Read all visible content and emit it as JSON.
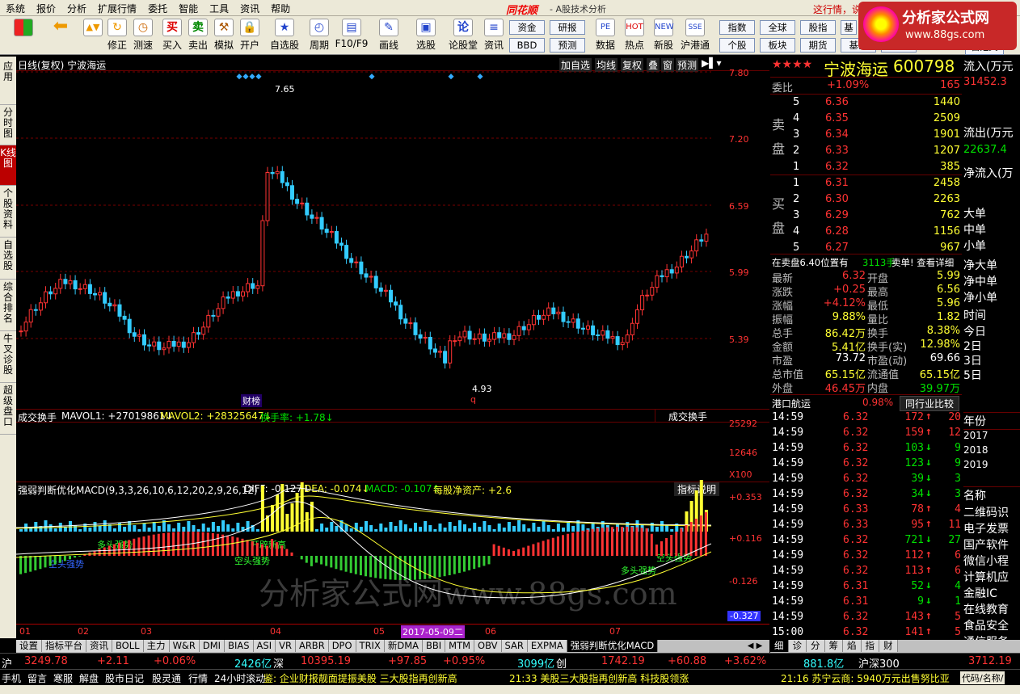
{
  "menu": [
    "系统",
    "报价",
    "分析",
    "扩展行情",
    "委托",
    "智能",
    "工具",
    "资讯",
    "帮助"
  ],
  "brand": "同花顺",
  "app_title": "- A股技术分析",
  "news_ticker": "这行情，说",
  "badge": {
    "t1": "分析家公式网",
    "t2": "www.88gs.com"
  },
  "toolbar": {
    "buttons": [
      "",
      "",
      "修正",
      "测速",
      "买入",
      "卖出",
      "模拟",
      "开户",
      "自选股",
      "周期",
      "F10/F9",
      "画线",
      "选股",
      "论股堂",
      "资讯",
      "数据",
      "热点",
      "新股",
      "沪港通"
    ],
    "quick": [
      [
        "资金",
        "研报"
      ],
      [
        "BBD",
        "预测"
      ]
    ],
    "right": [
      [
        "指数",
        "全球",
        "股指",
        "基"
      ],
      [
        "个股",
        "板块",
        "期货",
        "基金"
      ]
    ],
    "right_tail": [
      "外汇",
      "自定义"
    ]
  },
  "left_tabs": [
    "应用",
    "分时图",
    "K线图",
    "个股资料",
    "自选股",
    "综合排名",
    "牛叉诊股",
    "超级盘口"
  ],
  "chart": {
    "header": "日线(复权) 宁波海运",
    "buttons": [
      "加自选",
      "均线",
      "复权",
      "叠",
      "窗",
      "预测"
    ],
    "price_labels": [
      "7.80",
      "7.20",
      "6.59",
      "5.99",
      "5.39"
    ],
    "high_mark": "7.65",
    "low_mark": "4.93",
    "low_flag": "q",
    "event_flag": "财榜",
    "vol_header": {
      "name": "成交换手",
      "mavol1": "MAVOL1: +27019861↓",
      "mavol2": "MAVOL2: +28325647↓",
      "hsl": "换手率: +1.78↓"
    },
    "vol_select": "成交换手",
    "vol_labels": [
      "25292",
      "12646",
      "X100"
    ],
    "macd_header": {
      "name": "强弱判断优化MACD(9,3,3,26,10,6,12,20,2,9,26,12)",
      "diff": "DIFF: -0.127↓",
      "dea": "DEA: -0.074↓",
      "macd": "MACD: -0.107↑",
      "nav": "每股净资产: +2.6"
    },
    "macd_btn": "指标说明",
    "macd_labels": [
      "+0.353",
      "+0.116",
      "-0.126",
      "-0.327"
    ],
    "macd_tags": [
      "空头强势",
      "多头强势",
      "开辟新高",
      "空头强势",
      "多头强势",
      "空头强势"
    ],
    "watermark": "分析家公式网www.88gs.com",
    "x_labels": [
      "01",
      "02",
      "03",
      "04",
      "05",
      "06",
      "07"
    ],
    "date_cursor": "2017-05-09二"
  },
  "quote": {
    "stars": "★★★★",
    "name": "宁波海运",
    "code": "600798",
    "weibi_label": "委比",
    "weibi": "+1.09%",
    "weibi_val": "165",
    "sell_label": [
      "卖",
      "盘"
    ],
    "buy_label": [
      "买",
      "盘"
    ],
    "asks": [
      [
        "5",
        "6.36",
        "1440"
      ],
      [
        "4",
        "6.35",
        "2509"
      ],
      [
        "3",
        "6.34",
        "1901"
      ],
      [
        "2",
        "6.33",
        "1207"
      ],
      [
        "1",
        "6.32",
        "385"
      ]
    ],
    "bids": [
      [
        "1",
        "6.31",
        "2458"
      ],
      [
        "2",
        "6.30",
        "2263"
      ],
      [
        "3",
        "6.29",
        "762"
      ],
      [
        "4",
        "6.28",
        "1156"
      ],
      [
        "5",
        "6.27",
        "967"
      ]
    ],
    "pending": "在卖盘6.40位置有",
    "pending_qty": "3113手",
    "pending_tail": "卖单! 查看详细",
    "stats": [
      [
        "最新",
        "6.32",
        "开盘",
        "5.99"
      ],
      [
        "涨跌",
        "+0.25",
        "最高",
        "6.56"
      ],
      [
        "涨幅",
        "+4.12%",
        "最低",
        "5.96"
      ],
      [
        "振幅",
        "9.88%",
        "量比",
        "1.82"
      ],
      [
        "总手",
        "86.42万",
        "换手",
        "8.38%"
      ],
      [
        "金额",
        "5.41亿",
        "换手(实)",
        "12.98%"
      ],
      [
        "市盈",
        "73.72",
        "市盈(动)",
        "69.66"
      ],
      [
        "总市值",
        "65.15亿",
        "流通值",
        "65.15亿"
      ],
      [
        "外盘",
        "46.45万",
        "内盘",
        "39.97万"
      ]
    ],
    "sector": "港口航运",
    "sector_pct": "0.98%",
    "sector_btn": "同行业比较"
  },
  "flow": {
    "in_label": "流入(万元",
    "in_val": "31452.3",
    "out_label": "流出(万元",
    "out_val": "22637.4",
    "net_label": "净流入(万",
    "items": [
      "大单",
      "中单",
      "小单",
      "净大单",
      "净中单",
      "净小单",
      "时间",
      "今日",
      "2日",
      "3日",
      "5日"
    ],
    "year_header": "年份",
    "years": [
      "2017",
      "2018",
      "2019"
    ],
    "name_header": "名称",
    "names": [
      "二维码识",
      "电子发票",
      "国产软件",
      "微信小程",
      "计算机应",
      "金融IC",
      "在线教育",
      "食品安全",
      "通信服务"
    ]
  },
  "trades": [
    [
      "14:59",
      "6.32",
      "172",
      "↑",
      "20"
    ],
    [
      "14:59",
      "6.32",
      "159",
      "↑",
      "12"
    ],
    [
      "14:59",
      "6.32",
      "103",
      "↓",
      "9"
    ],
    [
      "14:59",
      "6.32",
      "123",
      "↓",
      "9"
    ],
    [
      "14:59",
      "6.32",
      "39",
      "↓",
      "3"
    ],
    [
      "14:59",
      "6.32",
      "34",
      "↓",
      "3"
    ],
    [
      "14:59",
      "6.33",
      "78",
      "↑",
      "4"
    ],
    [
      "14:59",
      "6.33",
      "95",
      "↑",
      "11"
    ],
    [
      "14:59",
      "6.32",
      "721",
      "↓",
      "27"
    ],
    [
      "14:59",
      "6.32",
      "112",
      "↑",
      "6"
    ],
    [
      "14:59",
      "6.32",
      "113",
      "↑",
      "6"
    ],
    [
      "14:59",
      "6.31",
      "52",
      "↓",
      "4"
    ],
    [
      "14:59",
      "6.31",
      "9",
      "↓",
      "1"
    ],
    [
      "14:59",
      "6.32",
      "143",
      "↑",
      "5"
    ],
    [
      "15:00",
      "6.32",
      "141",
      "↑",
      "5"
    ]
  ],
  "bottom_tabs": [
    "设置",
    "指标平台",
    "资讯",
    "BOLL",
    "主力",
    "W&R",
    "DMI",
    "BIAS",
    "ASI",
    "VR",
    "ARBR",
    "DPO",
    "TRIX",
    "新DMA",
    "BBI",
    "MTM",
    "OBV",
    "SAR",
    "EXPMA",
    "强弱判断优化MACD"
  ],
  "right_tabs": [
    "细",
    "诊",
    "分",
    "筹",
    "焰",
    "指",
    "财"
  ],
  "status1": {
    "hu": "沪",
    "hu_val": "3249.78",
    "hu_chg": "+2.11",
    "hu_pct": "+0.06%",
    "hu_amt": "2426亿",
    "shen": "深",
    "shen_val": "10395.19",
    "shen_chg": "+97.85",
    "shen_pct": "+0.95%",
    "shen_amt": "3099亿",
    "chuang": "创",
    "cy_val": "1742.19",
    "cy_chg": "+60.88",
    "cy_pct": "+3.62%",
    "tail": "881.8亿",
    "hs300": "沪深300",
    "hs300_val": "3712.19"
  },
  "status2": {
    "items": [
      "手机",
      "留言",
      "寒服",
      "解盘",
      "股市日记",
      "股灵通",
      "行情",
      "24小时滚动"
    ],
    "news1": "鉴: 企业财报靓面提振美股 三大股指再创新高",
    "news2": "21:33 美股三大股指再创新高 科技股领涨",
    "news3": "21:16 苏宁云商: 5940万元出售努比亚",
    "code_label": "代码/名称/"
  }
}
